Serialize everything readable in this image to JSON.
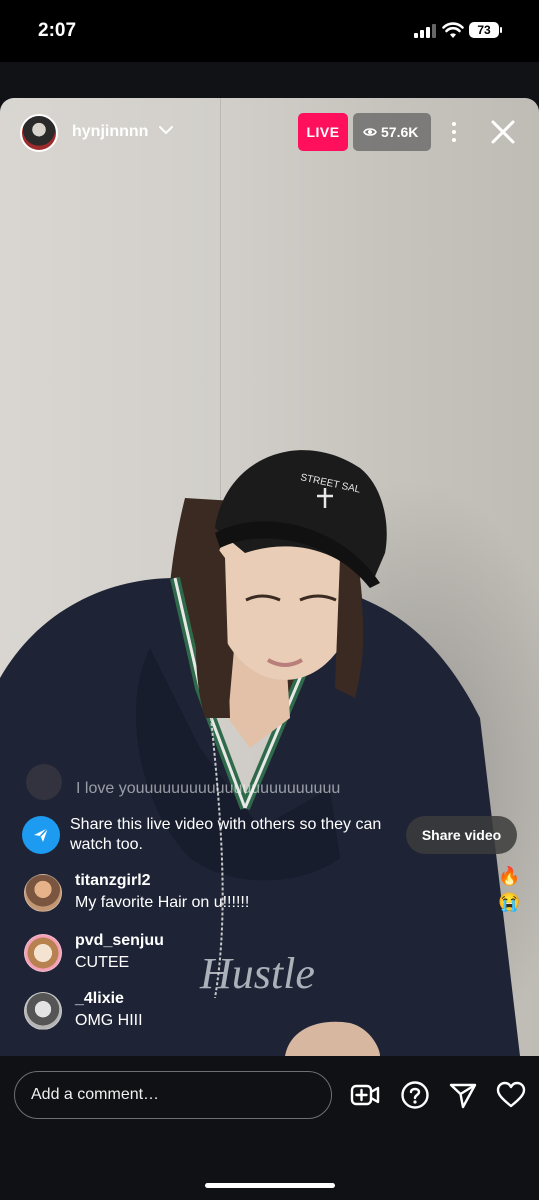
{
  "status_bar": {
    "time": "2:07",
    "battery": "73"
  },
  "live": {
    "username": "hynjinnnn",
    "live_label": "LIVE",
    "viewer_count": "57.6K"
  },
  "comments": {
    "faded_text": "I love youuuuuuuuuuuuuuuuuuuuuuu",
    "items": [
      {
        "user": "titanzgirl2",
        "text": "My favorite Hair on u!!!!!!"
      },
      {
        "user": "pvd_senjuu",
        "text": "CUTEE"
      },
      {
        "user": "_4lixie",
        "text": "OMG HIII"
      }
    ]
  },
  "share": {
    "message": "Share this live video with others so they can watch too.",
    "button_label": "Share video"
  },
  "reactions": {
    "fire": "🔥",
    "cry": "😭"
  },
  "bottom_bar": {
    "comment_placeholder": "Add a comment…",
    "icons": [
      "add-video-icon",
      "question-icon",
      "send-icon",
      "heart-icon"
    ]
  },
  "colors": {
    "live_badge": "#ff0f5c",
    "share_icon": "#1d9bf0",
    "background": "#0f1115"
  }
}
